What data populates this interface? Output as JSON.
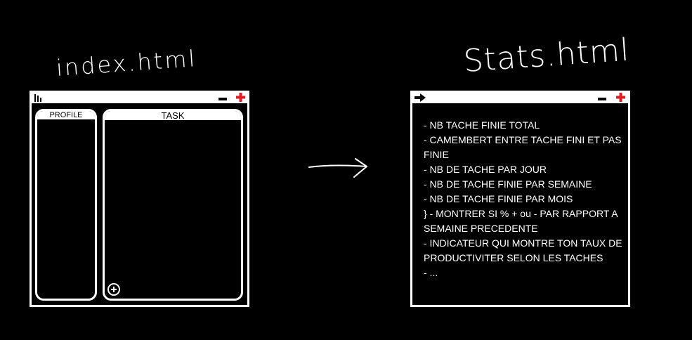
{
  "labels": {
    "index_title": "index.html",
    "stats_title": "Stats.html"
  },
  "index_window": {
    "icons": {
      "app_icon": "bar-chart-icon",
      "minimize_icon": "minimize-icon",
      "close_icon": "red-cross-icon"
    },
    "profile_panel": {
      "label": "PROFILE"
    },
    "task_panel": {
      "label": "TASK",
      "add_icon": "plus-circle-icon"
    }
  },
  "connector": {
    "icon": "arrow-right-icon"
  },
  "stats_window": {
    "icons": {
      "back_icon": "arrow-right-icon",
      "minimize_icon": "minimize-icon",
      "close_icon": "red-cross-icon"
    },
    "items": [
      "- NB TACHE FINIE TOTAL",
      "- CAMEMBERT ENTRE TACHE FINI ET PAS FINIE",
      "- NB DE TACHE PAR JOUR",
      "- NB DE TACHE FINIE PAR SEMAINE",
      "- NB DE TACHE FINIE PAR MOIS",
      "} - MONTRER SI % + ou - PAR RAPPORT A SEMAINE PRECEDENTE",
      "-  INDICATEUR QUI MONTRE TON TAUX DE PRODUCTIVITER SELON LES TACHES",
      "- ..."
    ]
  },
  "colors": {
    "background": "#000000",
    "foreground": "#ffffff",
    "close_accent": "#e31b23"
  }
}
